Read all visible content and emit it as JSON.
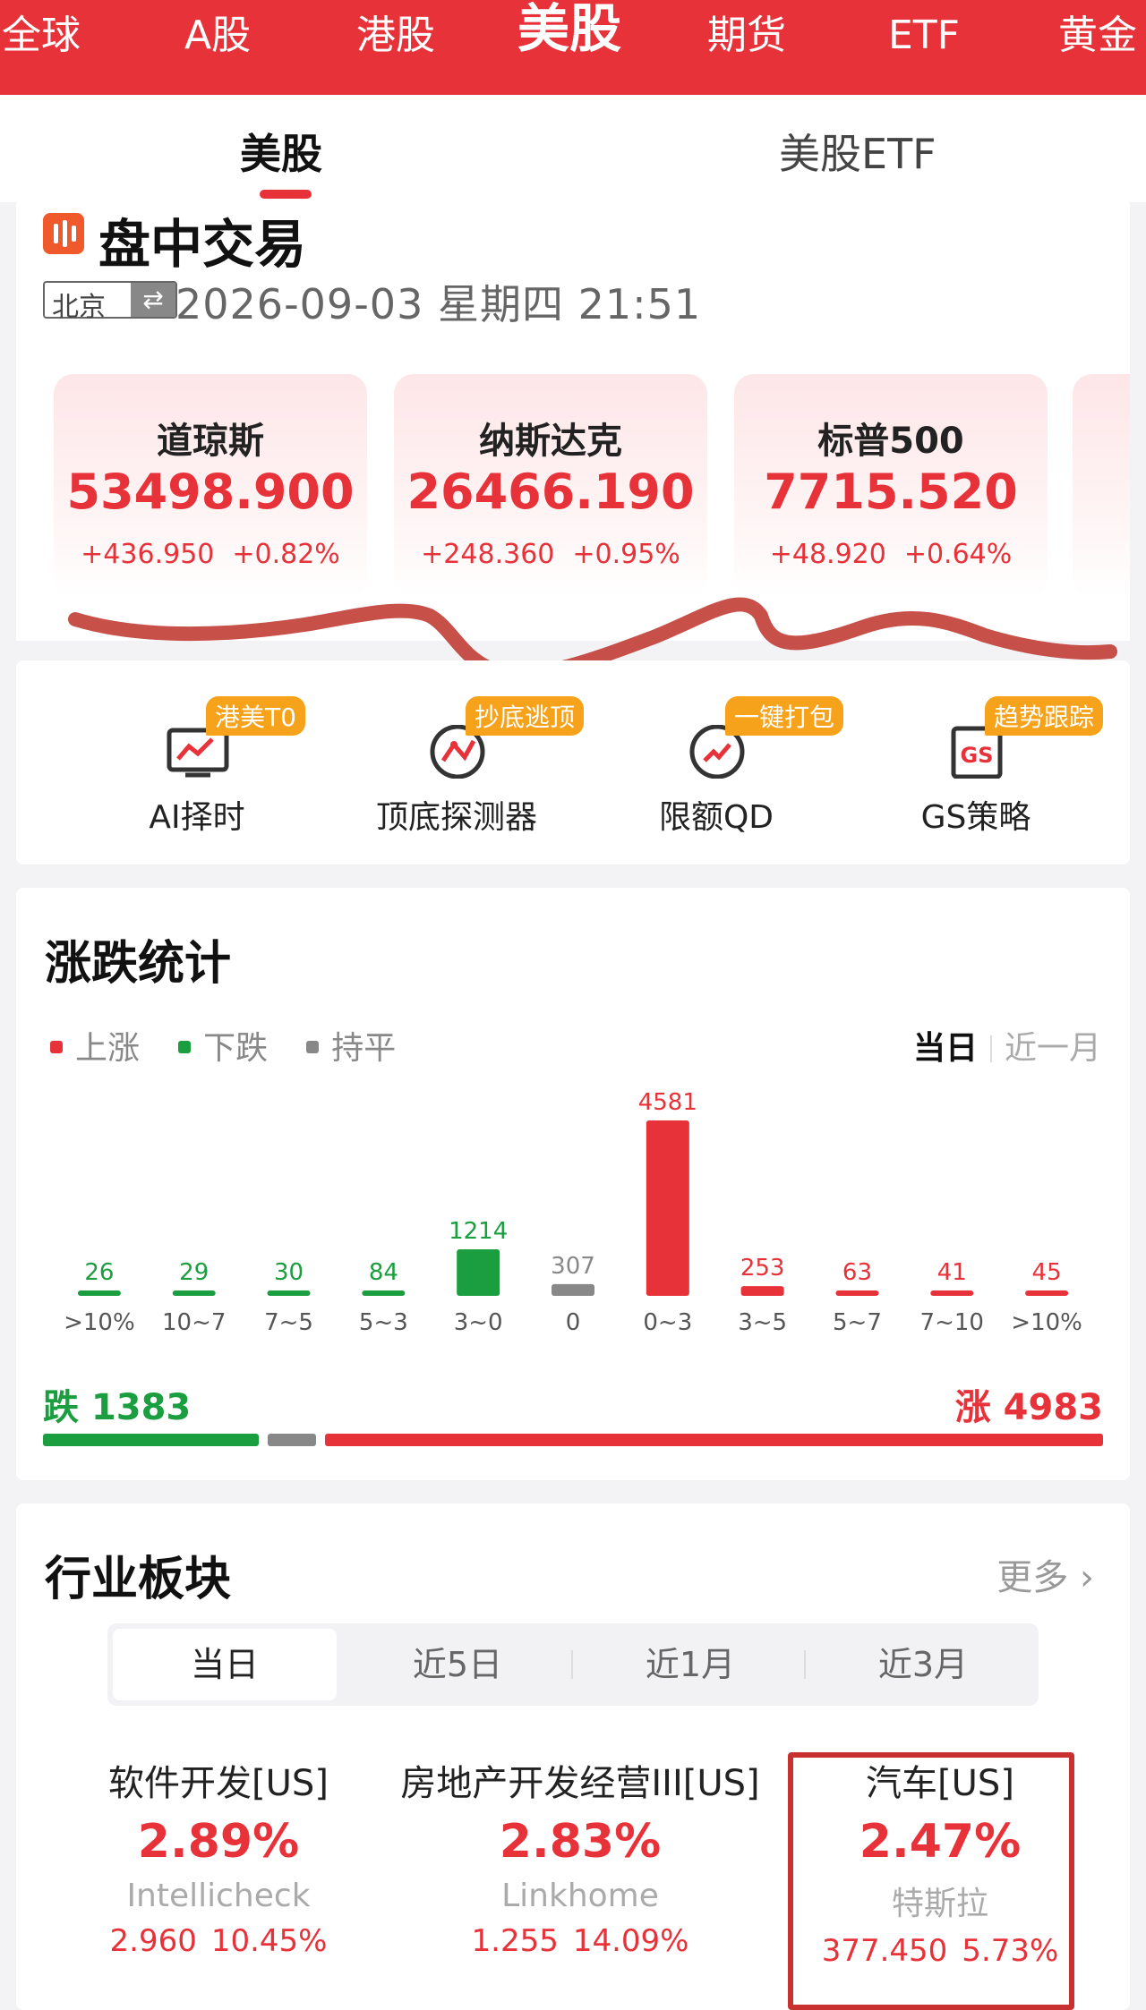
{
  "top_nav": {
    "items": [
      "全球",
      "A股",
      "港股",
      "美股",
      "期货",
      "ETF",
      "黄金"
    ],
    "active_index": 3
  },
  "sub_tabs": {
    "items": [
      "美股",
      "美股ETF"
    ],
    "active_index": 0
  },
  "intraday": {
    "title": "盘中交易",
    "timezone": "北京",
    "swap_symbol": "⇄",
    "datetime": "2026-09-03 星期四 21:51",
    "indices": [
      {
        "name": "道琼斯",
        "value": "53498.900",
        "change": "+436.950",
        "change_pct": "+0.82%"
      },
      {
        "name": "纳斯达克",
        "value": "26466.190",
        "change": "+248.360",
        "change_pct": "+0.95%"
      },
      {
        "name": "标普500",
        "value": "7715.520",
        "change": "+48.920",
        "change_pct": "+0.64%"
      }
    ]
  },
  "tools": [
    {
      "label": "AI择时",
      "badge": "港美T0",
      "icon": "chart-monitor-icon"
    },
    {
      "label": "顶底探测器",
      "badge": "抄底逃顶",
      "icon": "radar-icon"
    },
    {
      "label": "限额QD",
      "badge": "一键打包",
      "icon": "trend-up-circle-icon"
    },
    {
      "label": "GS策略",
      "badge": "趋势跟踪",
      "icon": "gs-strategy-icon"
    }
  ],
  "stats": {
    "title": "涨跌统计",
    "legend": [
      {
        "label": "上涨",
        "color": "#e8323a"
      },
      {
        "label": "下跌",
        "color": "#1a9e3f"
      },
      {
        "label": "持平",
        "color": "#888888"
      }
    ],
    "period_active": "当日",
    "period_other": "近一月",
    "down_label": "跌 1383",
    "up_label": "涨 4983",
    "breadth": {
      "down": 1383,
      "flat": 307,
      "up": 4983
    }
  },
  "chart_data": {
    "type": "bar",
    "categories": [
      ">10%",
      "10~7",
      "7~5",
      "5~3",
      "3~0",
      "0",
      "0~3",
      "3~5",
      "5~7",
      "7~10",
      ">10%"
    ],
    "values": [
      26,
      29,
      30,
      84,
      1214,
      307,
      4581,
      253,
      63,
      41,
      45
    ],
    "colors": [
      "#1a9e3f",
      "#1a9e3f",
      "#1a9e3f",
      "#1a9e3f",
      "#1a9e3f",
      "#888888",
      "#e8323a",
      "#e8323a",
      "#e8323a",
      "#e8323a",
      "#e8323a"
    ],
    "legend": [
      "上涨",
      "下跌",
      "持平"
    ],
    "legend_placement": "top-left",
    "grid": false
  },
  "sectors": {
    "title": "行业板块",
    "more_label": "更多",
    "tabs": [
      "当日",
      "近5日",
      "近1月",
      "近3月"
    ],
    "active_tab": 0,
    "items": [
      {
        "name": "软件开发[US]",
        "pct": "2.89%",
        "stock": "Intellicheck",
        "price": "2.960",
        "stock_pct": "10.45%"
      },
      {
        "name": "房地产开发经营III[US]",
        "pct": "2.83%",
        "stock": "Linkhome",
        "price": "1.255",
        "stock_pct": "14.09%"
      },
      {
        "name": "汽车[US]",
        "pct": "2.47%",
        "stock": "特斯拉",
        "price": "377.450",
        "stock_pct": "5.73%"
      }
    ]
  }
}
